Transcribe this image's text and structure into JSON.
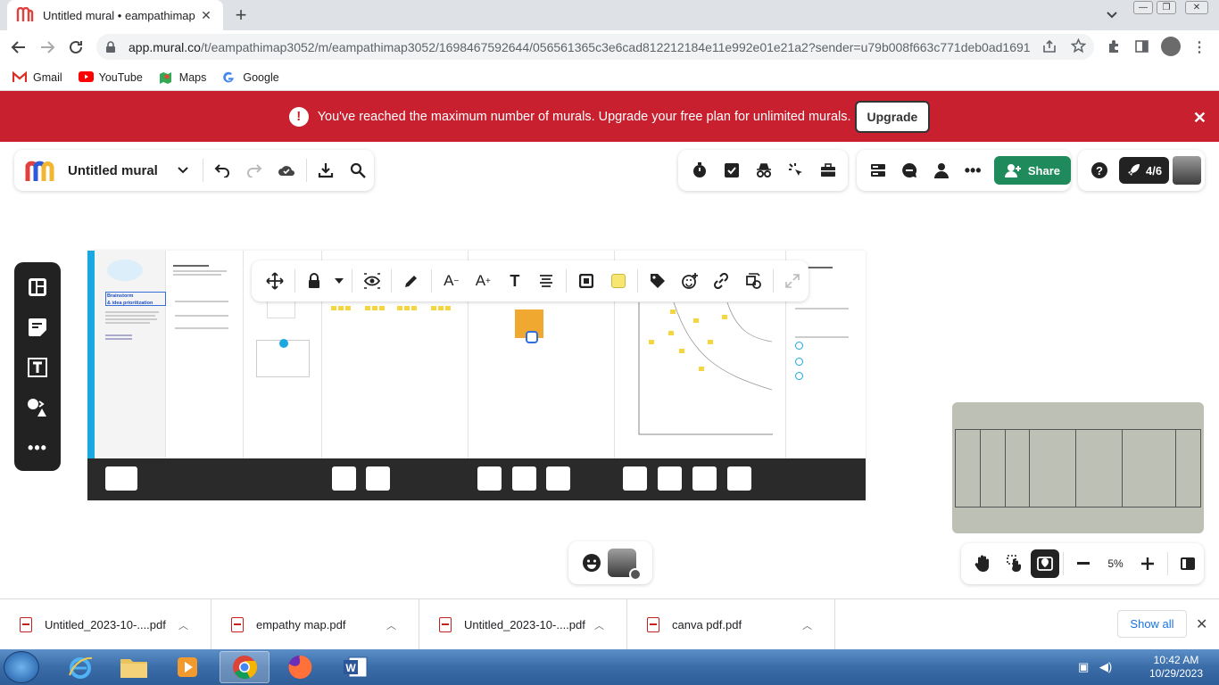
{
  "browser": {
    "tab_title": "Untitled mural • eampathimap",
    "url_host": "app.mural.co",
    "url_path": "/t/eampathimap3052/m/eampathimap3052/1698467592644/056561365c3e6cad812212184e11e992e01e21a2?sender=u79b008f663c771deb0ad1691",
    "bookmarks": [
      "Gmail",
      "YouTube",
      "Maps",
      "Google"
    ]
  },
  "banner": {
    "message": "You've reached the maximum number of murals. Upgrade your free plan for unlimited murals.",
    "upgrade_label": "Upgrade"
  },
  "mural": {
    "title": "Untitled mural",
    "share_label": "Share",
    "participants": "4/6",
    "zoom": "5%"
  },
  "board": {
    "intro_title_line1": "Brainstorm",
    "intro_title_line2": "& idea prioritization"
  },
  "downloads": {
    "items": [
      "Untitled_2023-10-....pdf",
      "empathy map.pdf",
      "Untitled_2023-10-....pdf",
      "canva pdf.pdf"
    ],
    "show_all": "Show all"
  },
  "taskbar": {
    "time": "10:42 AM",
    "date": "10/29/2023"
  },
  "colors": {
    "banner_red": "#c8202f",
    "share_green": "#1f8a5b",
    "sticky_yellow": "#f5d63c"
  }
}
